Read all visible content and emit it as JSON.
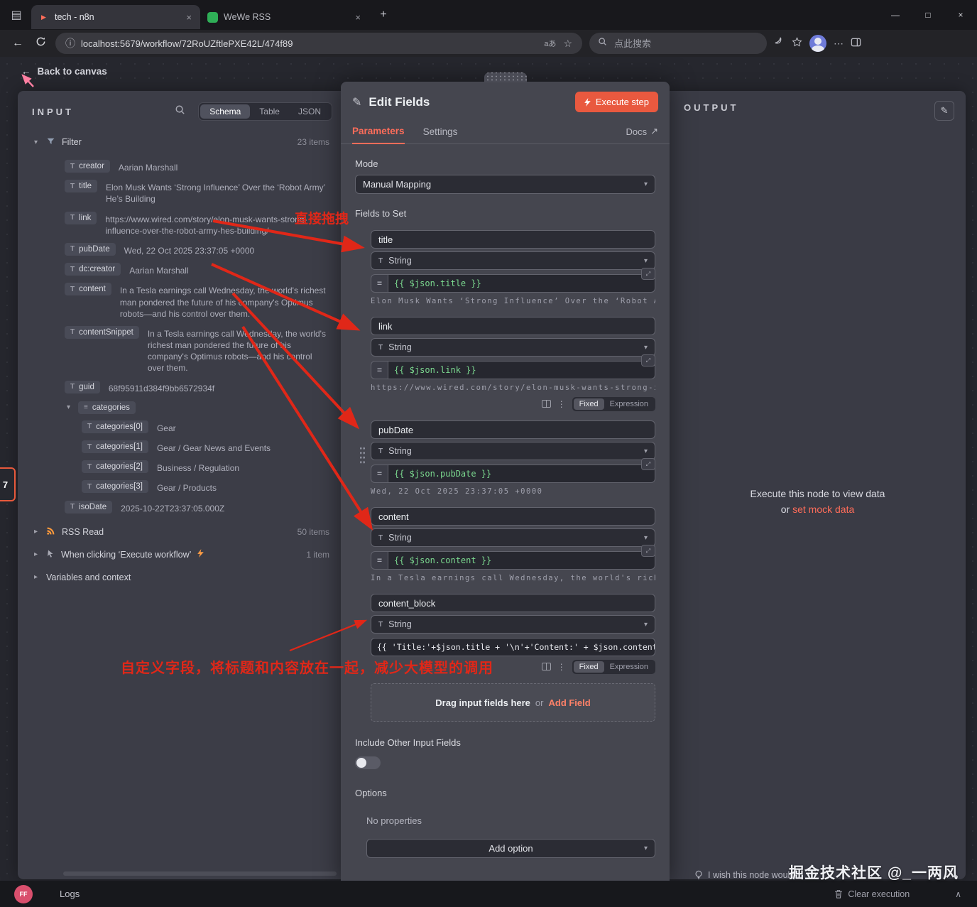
{
  "browser": {
    "tabs": [
      {
        "title": "tech - n8n"
      },
      {
        "title": "WeWe RSS"
      }
    ],
    "url": "localhost:5679/workflow/72RoUZftlePXE42L/474f89",
    "lang_badge": "aあ",
    "search_placeholder": "点此搜索"
  },
  "back_link": "Back to canvas",
  "side_node_label": "7",
  "input_panel": {
    "title": "INPUT",
    "tabs": {
      "schema": "Schema",
      "table": "Table",
      "json": "JSON"
    },
    "filter": {
      "label": "Filter",
      "count": "23 items",
      "fields": [
        {
          "name": "creator",
          "value": "Aarian Marshall"
        },
        {
          "name": "title",
          "value": "Elon Musk Wants ‘Strong Influence’ Over the ‘Robot Army’ He’s Building"
        },
        {
          "name": "link",
          "value": "https://www.wired.com/story/elon-musk-wants-strong-influence-over-the-robot-army-hes-building/"
        },
        {
          "name": "pubDate",
          "value": "Wed, 22 Oct 2025 23:37:05 +0000"
        },
        {
          "name": "dc:creator",
          "value": "Aarian Marshall"
        },
        {
          "name": "content",
          "value": "In a Tesla earnings call Wednesday, the world's richest man pondered the future of his company's Optimus robots—and his control over them."
        },
        {
          "name": "contentSnippet",
          "value": "In a Tesla earnings call Wednesday, the world's richest man pondered the future of his company's Optimus robots—and his control over them."
        },
        {
          "name": "guid",
          "value": "68f95911d384f9bb6572934f"
        }
      ],
      "categories": {
        "label": "categories",
        "items": [
          {
            "name": "categories[0]",
            "value": "Gear"
          },
          {
            "name": "categories[1]",
            "value": "Gear / Gear News and Events"
          },
          {
            "name": "categories[2]",
            "value": "Business / Regulation"
          },
          {
            "name": "categories[3]",
            "value": "Gear / Products"
          }
        ]
      },
      "isoDate": {
        "name": "isoDate",
        "value": "2025-10-22T23:37:05.000Z"
      }
    },
    "groups": [
      {
        "label": "RSS Read",
        "count": "50 items"
      },
      {
        "label": "When clicking ‘Execute workflow’",
        "count": "1 item"
      },
      {
        "label": "Variables and context",
        "count": ""
      }
    ]
  },
  "dialog": {
    "title": "Edit Fields",
    "execute_button": "Execute step",
    "tabs": {
      "parameters": "Parameters",
      "settings": "Settings",
      "docs": "Docs"
    },
    "mode_label": "Mode",
    "mode_value": "Manual Mapping",
    "fields_to_set": "Fields to Set",
    "fields": [
      {
        "name": "title",
        "type": "String",
        "expr": "{{ $json.title }}",
        "preview": "Elon Musk Wants ‘Strong Influence’ Over the ‘Robot A…"
      },
      {
        "name": "link",
        "type": "String",
        "expr": "{{ $json.link }}",
        "preview": "https://www.wired.com/story/elon-musk-wants-strong-influence-ov…"
      },
      {
        "name": "pubDate",
        "type": "String",
        "expr": "{{ $json.pubDate }}",
        "preview": "Wed, 22 Oct 2025 23:37:05 +0000"
      },
      {
        "name": "content",
        "type": "String",
        "expr": "{{ $json.content }}",
        "preview": "In a Tesla earnings call Wednesday, the world's riches…"
      },
      {
        "name": "content_block",
        "type": "String",
        "expr": "{{ 'Title:'+$json.title + '\\n'+'Content:' + $json.content }}"
      }
    ],
    "fx": {
      "fixed": "Fixed",
      "expression": "Expression"
    },
    "drop_area": {
      "drag": "Drag input fields here",
      "or": "or",
      "add": "Add Field"
    },
    "include_other_label": "Include Other Input Fields",
    "options_label": "Options",
    "options_empty": "No properties",
    "add_option": "Add option"
  },
  "output_panel": {
    "title": "OUTPUT",
    "message_line1": "Execute this node to view data",
    "message_or": "or",
    "mock_link": "set mock data"
  },
  "annotations": {
    "drag_note": "直接拖拽",
    "custom_note": "自定义字段，将标题和内容放在一起，减少大模型的调用"
  },
  "footer": {
    "logs": "Logs",
    "wish": "I wish this node would...",
    "clear": "Clear execution",
    "watermark": "掘金技术社区 @_一两风",
    "avatar": "FF"
  }
}
